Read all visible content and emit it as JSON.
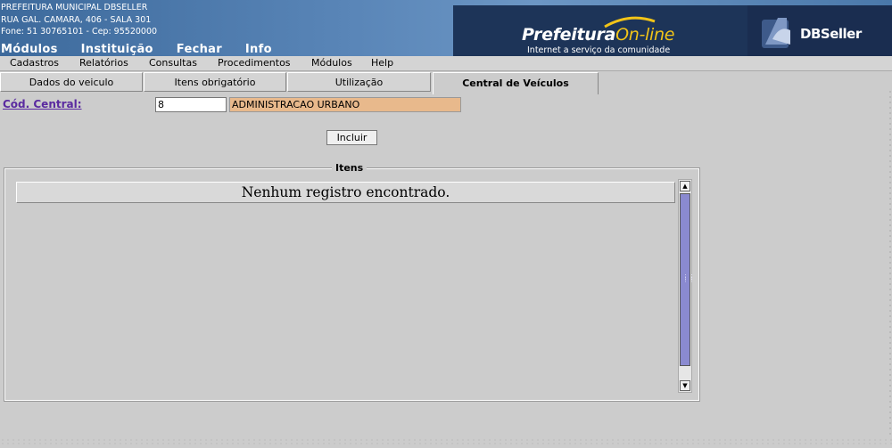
{
  "header": {
    "institution_line1": "PREFEITURA MUNICIPAL DBSELLER",
    "institution_line2": "RUA GAL. CAMARA, 406 - SALA 301",
    "institution_line3": "Fone: 51 30765101  -  Cep: 95520000",
    "nav": [
      "Módulos",
      "Instituição",
      "Fechar",
      "Info"
    ],
    "logo_main": "Prefeitura",
    "logo_online": "On-line",
    "logo_tagline": "Internet a serviço da comunidade",
    "vendor_logo": "DBSeller"
  },
  "menubar": [
    "Cadastros",
    "Relatórios",
    "Consultas",
    "Procedimentos",
    "Módulos",
    "Help"
  ],
  "tabs": [
    {
      "label": "Dados do veiculo",
      "active": false
    },
    {
      "label": "Itens obrigatório",
      "active": false
    },
    {
      "label": "Utilização",
      "active": false
    },
    {
      "label": "Central de Veículos",
      "active": true
    }
  ],
  "form": {
    "cod_central_label": "Cód. Central:",
    "cod_central_value": "8",
    "description_value": "ADMINISTRACAO URBANO",
    "incluir_label": "Incluir"
  },
  "items_panel": {
    "legend": "Itens",
    "empty_message": "Nenhum registro encontrado."
  },
  "colors": {
    "banner": "#4a78aa",
    "description_field": "#e8b98c",
    "link_label": "#5a2aa0",
    "scroll_thumb": "#8a8ad0"
  }
}
